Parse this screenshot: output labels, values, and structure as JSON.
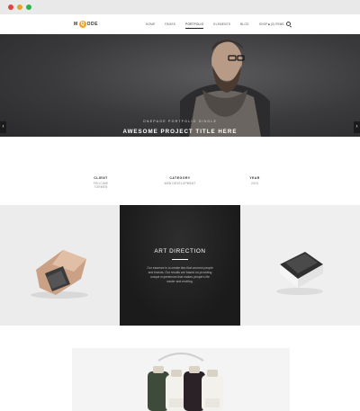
{
  "window": {
    "controls": [
      "close",
      "minimize",
      "maximize"
    ]
  },
  "nav": {
    "logo_left": "M",
    "logo_mark": "Q",
    "logo_right": "ODE",
    "items": [
      {
        "label": "HOME"
      },
      {
        "label": "PAGES"
      },
      {
        "label": "PORTFOLIO"
      },
      {
        "label": "ELEMENTS"
      },
      {
        "label": "BLOG"
      },
      {
        "label": "SHOP"
      }
    ],
    "active_index": 2,
    "cart": "(0) ITEMS"
  },
  "hero": {
    "subtitle": "ONEPAGE PORTFOLIO SINGLE",
    "title": "AWESOME PROJECT TITLE HERE",
    "prev_arrow": "‹",
    "next_arrow": "›"
  },
  "details": [
    {
      "label": "CLIENT",
      "value": "FELICIME TORMEN"
    },
    {
      "label": "CATEGORY",
      "value": "WEB DEVELOPMENT"
    },
    {
      "label": "YEAR",
      "value": "2015"
    }
  ],
  "feature": {
    "title": "Art Direction",
    "text": "Our essence is to create ties that connect people and brands. Our results are based on providing unique experiences that makes people's life easier and exciting."
  },
  "colors": {
    "accent": "#f4a522",
    "dark_tile": "#1e1e1e",
    "hero_overlay": "#3e3e40"
  }
}
